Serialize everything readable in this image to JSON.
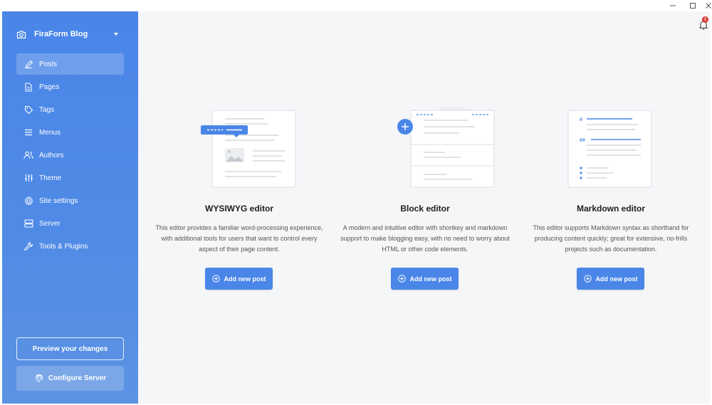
{
  "window": {
    "controls": {
      "minimize": "minimize-icon",
      "maximize": "maximize-icon",
      "close": "close-icon"
    }
  },
  "sidebar": {
    "site_name": "FiraForm Blog",
    "items": [
      {
        "label": "Posts",
        "icon": "pencil-icon",
        "active": true
      },
      {
        "label": "Pages",
        "icon": "page-icon",
        "active": false
      },
      {
        "label": "Tags",
        "icon": "tag-icon",
        "active": false
      },
      {
        "label": "Menus",
        "icon": "menu-icon",
        "active": false
      },
      {
        "label": "Authors",
        "icon": "users-icon",
        "active": false
      },
      {
        "label": "Theme",
        "icon": "sliders-icon",
        "active": false
      },
      {
        "label": "Site settings",
        "icon": "gear-icon",
        "active": false
      },
      {
        "label": "Server",
        "icon": "server-icon",
        "active": false
      },
      {
        "label": "Tools & Plugins",
        "icon": "wrench-icon",
        "active": false
      }
    ],
    "preview_label": "Preview your changes",
    "configure_label": "Configure Server"
  },
  "header": {
    "notification_count": "1"
  },
  "editors": [
    {
      "title": "WYSIWYG editor",
      "description": "This editor provides a familiar word-processing experience, with additional tools for users that want to control every aspect of their page content.",
      "button_label": "Add new post"
    },
    {
      "title": "Block editor",
      "description": "A modern and intuitive editor with shortkey and markdown support to make blogging easy, with no need to worry about HTML or other code elements.",
      "button_label": "Add new post"
    },
    {
      "title": "Markdown editor",
      "description": "This editor supports Markdown syntax as shorthand for producing content quickly; great for extensive, no-frills projects such as documentation.",
      "button_label": "Add new post"
    }
  ],
  "colors": {
    "accent": "#4a86e8",
    "sidebar_bg": "#4f8ae6",
    "main_bg": "#f5f6f8",
    "badge": "#d9352c"
  }
}
